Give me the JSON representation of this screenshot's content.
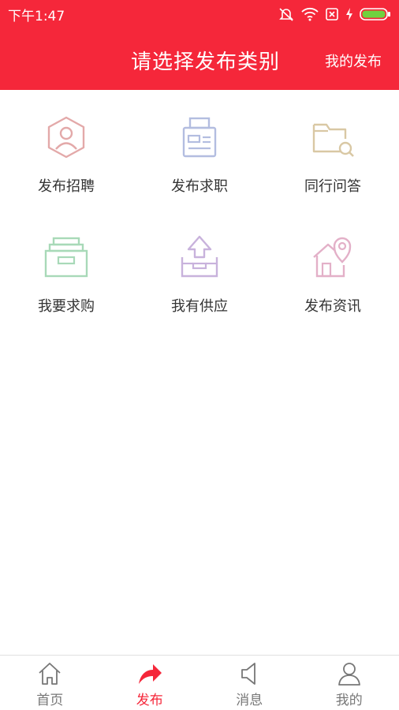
{
  "status_bar": {
    "time": "下午1:47"
  },
  "header": {
    "title": "请选择发布类别",
    "my_posts_label": "我的发布",
    "background_color": "#f5273a"
  },
  "categories": [
    {
      "label": "发布招聘",
      "icon": "user-hexagon-icon",
      "color": "#e3a9a9"
    },
    {
      "label": "发布求职",
      "icon": "printer-icon",
      "color": "#b3bde0"
    },
    {
      "label": "同行问答",
      "icon": "folder-search-icon",
      "color": "#d9c8a4"
    },
    {
      "label": "我要求购",
      "icon": "inbox-tray-icon",
      "color": "#a8d9b8"
    },
    {
      "label": "我有供应",
      "icon": "upload-box-icon",
      "color": "#c8b2dc"
    },
    {
      "label": "发布资讯",
      "icon": "house-location-icon",
      "color": "#e3b0c8"
    }
  ],
  "tabbar": {
    "items": [
      {
        "label": "首页",
        "icon": "home-icon",
        "active": false
      },
      {
        "label": "发布",
        "icon": "share-arrow-icon",
        "active": true
      },
      {
        "label": "消息",
        "icon": "megaphone-icon",
        "active": false
      },
      {
        "label": "我的",
        "icon": "person-icon",
        "active": false
      }
    ],
    "active_color": "#f5273a"
  }
}
